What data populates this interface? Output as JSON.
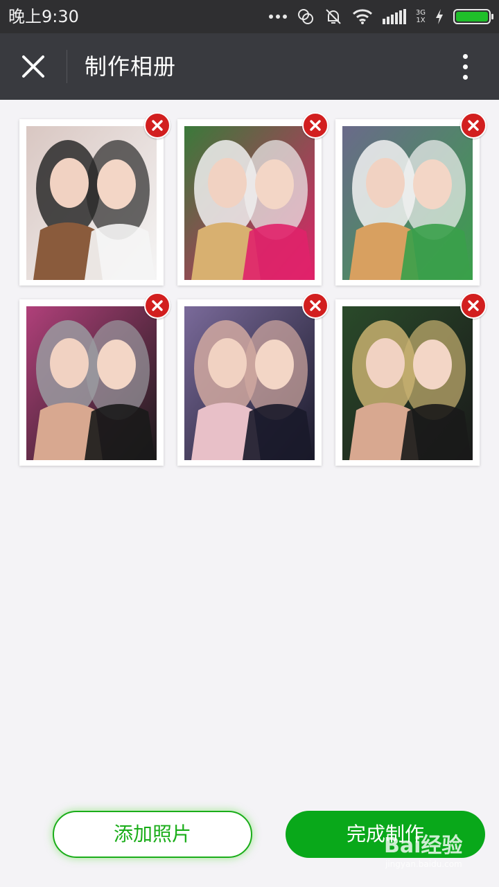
{
  "status_bar": {
    "time": "晚上9:30",
    "network_type": "3G",
    "network_sim": "1X",
    "icons": [
      "more-dots-icon",
      "sync-icon",
      "mute-bell-icon",
      "wifi-icon",
      "signal-icon",
      "charging-icon",
      "battery-icon"
    ],
    "battery_level": 1.0
  },
  "header": {
    "title": "制作相册",
    "close_icon": "close-icon",
    "more_icon": "more-vertical-icon"
  },
  "photos": [
    {
      "alt": "photo-1",
      "palette": [
        "#d9c7c2",
        "#f5f5f5",
        "#8a5b3c",
        "#2a2a2a"
      ]
    },
    {
      "alt": "photo-2",
      "palette": [
        "#3a7a3a",
        "#e0226a",
        "#d8b070",
        "#f0f0f0"
      ]
    },
    {
      "alt": "photo-3",
      "palette": [
        "#6a6a8a",
        "#3aa04a",
        "#d8a060",
        "#f2f2f2"
      ]
    },
    {
      "alt": "photo-4",
      "palette": [
        "#b0407a",
        "#1a1a1a",
        "#d8a890",
        "#9a9aa0"
      ]
    },
    {
      "alt": "photo-5",
      "palette": [
        "#7a6a9a",
        "#1a1a2a",
        "#e8c0c8",
        "#d0a8a0"
      ]
    },
    {
      "alt": "photo-6",
      "palette": [
        "#2a4a2a",
        "#1a1a1a",
        "#d8a890",
        "#c8b070"
      ]
    }
  ],
  "delete_icon": "remove-icon",
  "actions": {
    "add_label": "添加照片",
    "done_label": "完成制作"
  },
  "watermark": {
    "brand": "Bai经验",
    "url": "jingyan.baidu.com"
  },
  "colors": {
    "accent_green": "#1aad19",
    "delete_red": "#d21f1f",
    "header_bg": "#393a3f"
  }
}
